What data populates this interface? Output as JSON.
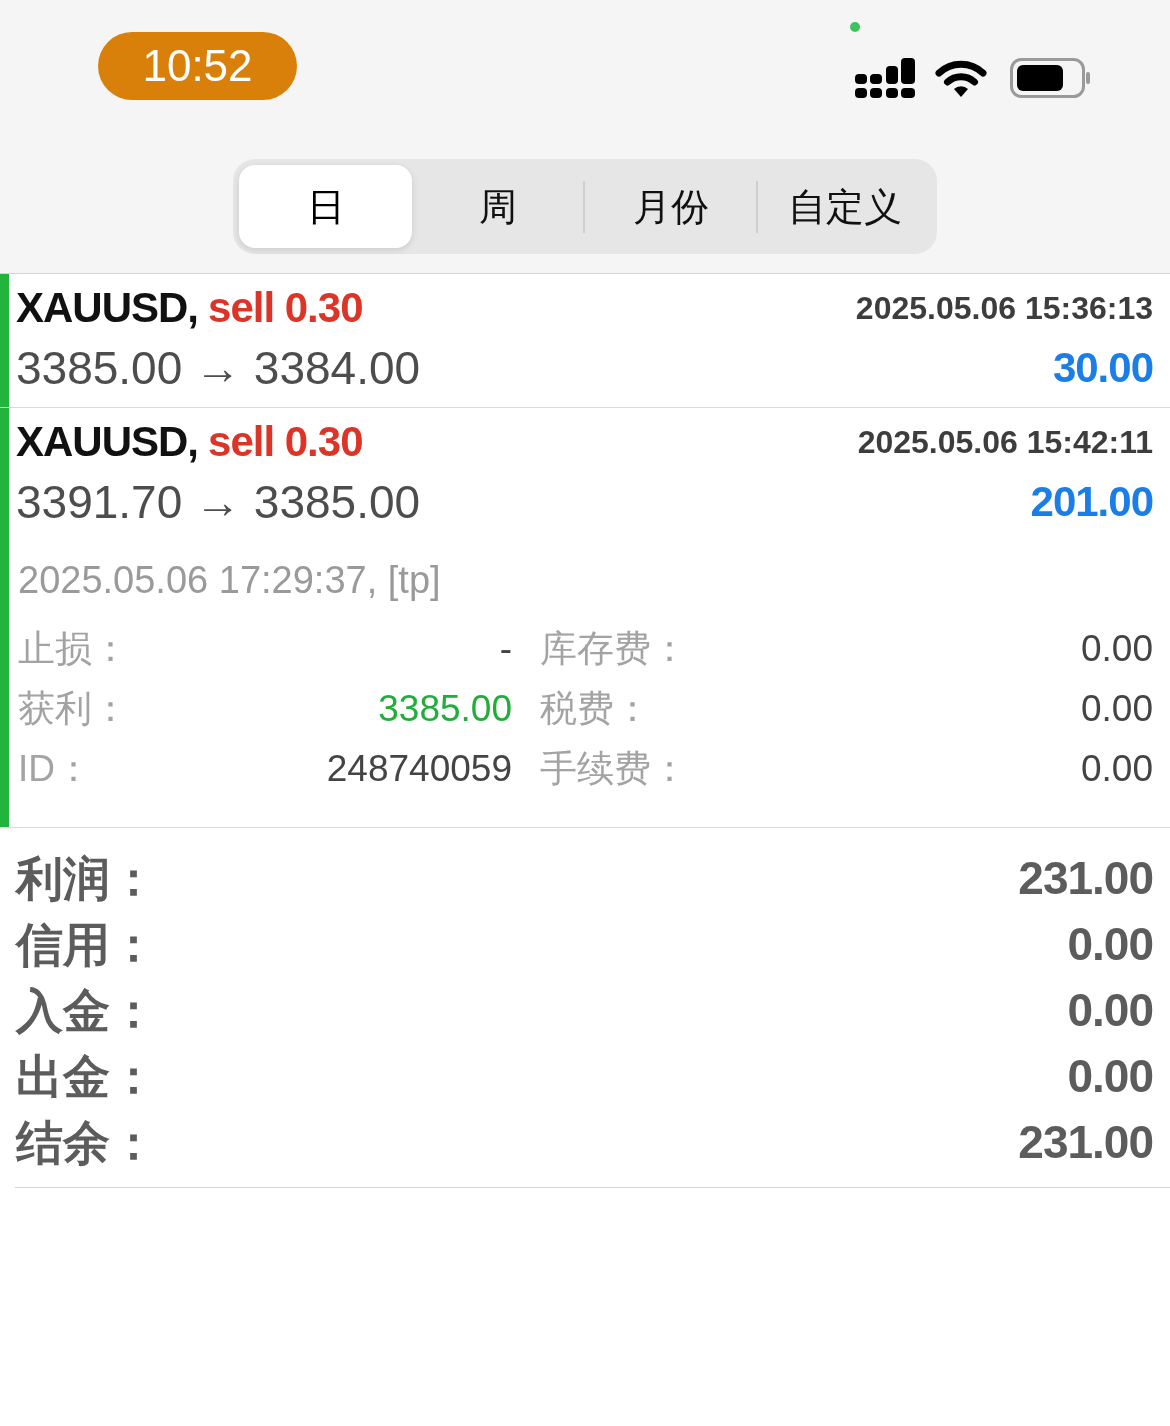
{
  "status_bar": {
    "time": "10:52"
  },
  "period_tabs": [
    {
      "label": "日",
      "selected": true
    },
    {
      "label": "周",
      "selected": false
    },
    {
      "label": "月份",
      "selected": false
    },
    {
      "label": "自定义",
      "selected": false
    }
  ],
  "deals": [
    {
      "color": "#22b43c",
      "symbol": "XAUUSD,",
      "side": "sell 0.30",
      "open_time": "2025.05.06 15:36:13",
      "prices": "3385.00 → 3384.00",
      "profit": "30.00"
    },
    {
      "color": "#22b43c",
      "symbol": "XAUUSD,",
      "side": "sell 0.30",
      "open_time": "2025.05.06 15:42:11",
      "prices": "3391.70 → 3385.00",
      "profit": "201.00",
      "details": {
        "close_time": "2025.05.06 17:29:37, [tp]",
        "rows": [
          {
            "left": {
              "label": "止损：",
              "value": "-",
              "color": "#444444"
            },
            "right": {
              "label": "库存费：",
              "value": "0.00",
              "color": "#444444"
            }
          },
          {
            "left": {
              "label": "获利：",
              "value": "3385.00",
              "color": "#22ad3a"
            },
            "right": {
              "label": "税费：",
              "value": "0.00",
              "color": "#444444"
            }
          },
          {
            "left": {
              "label": "ID：",
              "value": "248740059",
              "color": "#444444"
            },
            "right": {
              "label": "手续费：",
              "value": "0.00",
              "color": "#444444"
            }
          }
        ]
      }
    }
  ],
  "summary": [
    {
      "label": "利润：",
      "value": "231.00"
    },
    {
      "label": "信用：",
      "value": "0.00"
    },
    {
      "label": "入金：",
      "value": "0.00"
    },
    {
      "label": "出金：",
      "value": "0.00"
    },
    {
      "label": "结余：",
      "value": "231.00"
    }
  ]
}
